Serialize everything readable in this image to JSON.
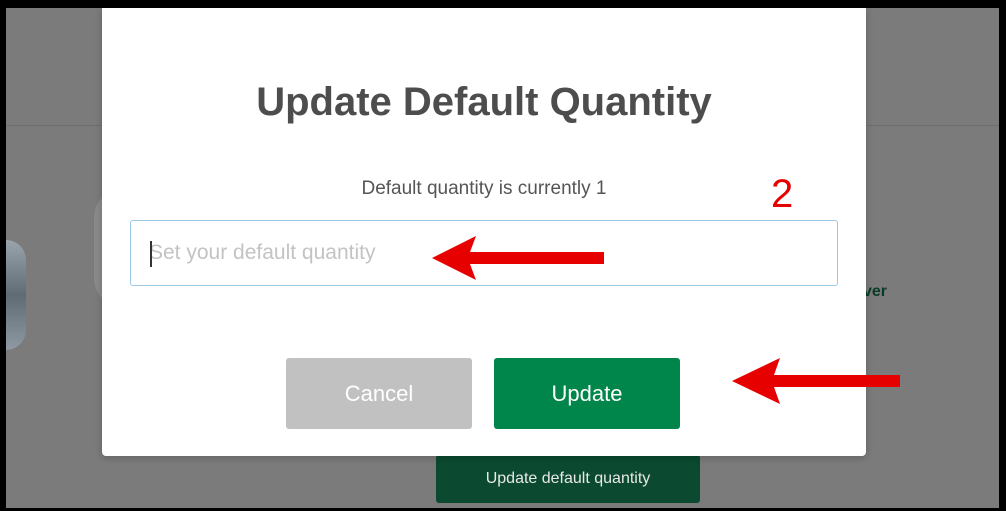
{
  "modal": {
    "title": "Update Default Quantity",
    "subtitle": "Default quantity is currently 1",
    "input": {
      "value": "",
      "placeholder": "Set your default quantity"
    },
    "cancel_label": "Cancel",
    "update_label": "Update"
  },
  "background": {
    "partial_text": "ver",
    "update_default_button_label": "Update default quantity"
  },
  "annotation": {
    "step_number": "2"
  },
  "colors": {
    "update_button": "#00854a",
    "cancel_button": "#c1c1c1",
    "annotation_red": "#e60000",
    "overlay": "#7b7b7b"
  },
  "icons": {
    "arrow_input": "left-arrow-icon",
    "arrow_update": "left-arrow-icon"
  }
}
